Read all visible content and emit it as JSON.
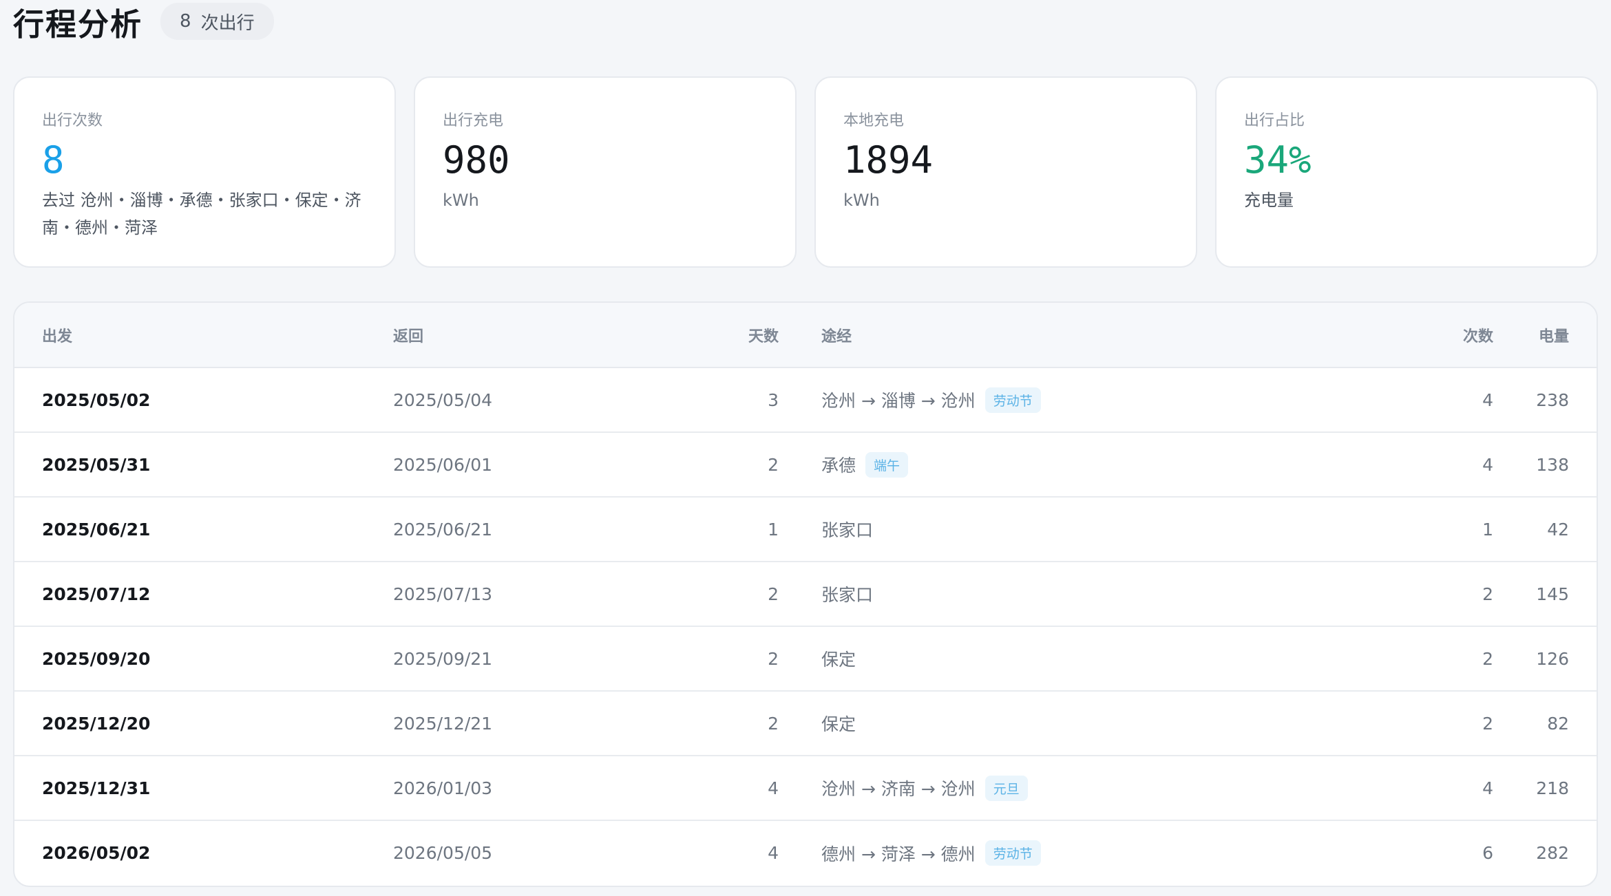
{
  "header": {
    "title": "行程分析",
    "badge_count": "8",
    "badge_unit": "次出行"
  },
  "cards": [
    {
      "label": "出行次数",
      "value": "8",
      "sub": "去过 沧州・淄博・承德・张家口・保定・济南・德州・菏泽"
    },
    {
      "label": "出行充电",
      "value": "980",
      "sub": "kWh"
    },
    {
      "label": "本地充电",
      "value": "1894",
      "sub": "kWh"
    },
    {
      "label": "出行占比",
      "value": "34%",
      "sub": "充电量"
    }
  ],
  "table": {
    "headers": {
      "dep": "出发",
      "ret": "返回",
      "days": "天数",
      "route": "途经",
      "count": "次数",
      "power": "电量"
    },
    "rows": [
      {
        "dep": "2025/05/02",
        "ret": "2025/05/04",
        "days": "3",
        "route": "沧州 → 淄博 → 沧州",
        "tag": "劳动节",
        "count": "4",
        "power": "238"
      },
      {
        "dep": "2025/05/31",
        "ret": "2025/06/01",
        "days": "2",
        "route": "承德",
        "tag": "端午",
        "count": "4",
        "power": "138"
      },
      {
        "dep": "2025/06/21",
        "ret": "2025/06/21",
        "days": "1",
        "route": "张家口",
        "tag": "",
        "count": "1",
        "power": "42"
      },
      {
        "dep": "2025/07/12",
        "ret": "2025/07/13",
        "days": "2",
        "route": "张家口",
        "tag": "",
        "count": "2",
        "power": "145"
      },
      {
        "dep": "2025/09/20",
        "ret": "2025/09/21",
        "days": "2",
        "route": "保定",
        "tag": "",
        "count": "2",
        "power": "126"
      },
      {
        "dep": "2025/12/20",
        "ret": "2025/12/21",
        "days": "2",
        "route": "保定",
        "tag": "",
        "count": "2",
        "power": "82"
      },
      {
        "dep": "2025/12/31",
        "ret": "2026/01/03",
        "days": "4",
        "route": "沧州 → 济南 → 沧州",
        "tag": "元旦",
        "count": "4",
        "power": "218"
      },
      {
        "dep": "2026/05/02",
        "ret": "2026/05/05",
        "days": "4",
        "route": "德州 → 菏泽 → 德州",
        "tag": "劳动节",
        "count": "6",
        "power": "282"
      }
    ]
  },
  "colors": {
    "accent_blue": "#1aa0e8",
    "accent_green": "#1aa77a",
    "tag_text": "#5cb3e6",
    "tag_bg": "#eaf5fc"
  }
}
